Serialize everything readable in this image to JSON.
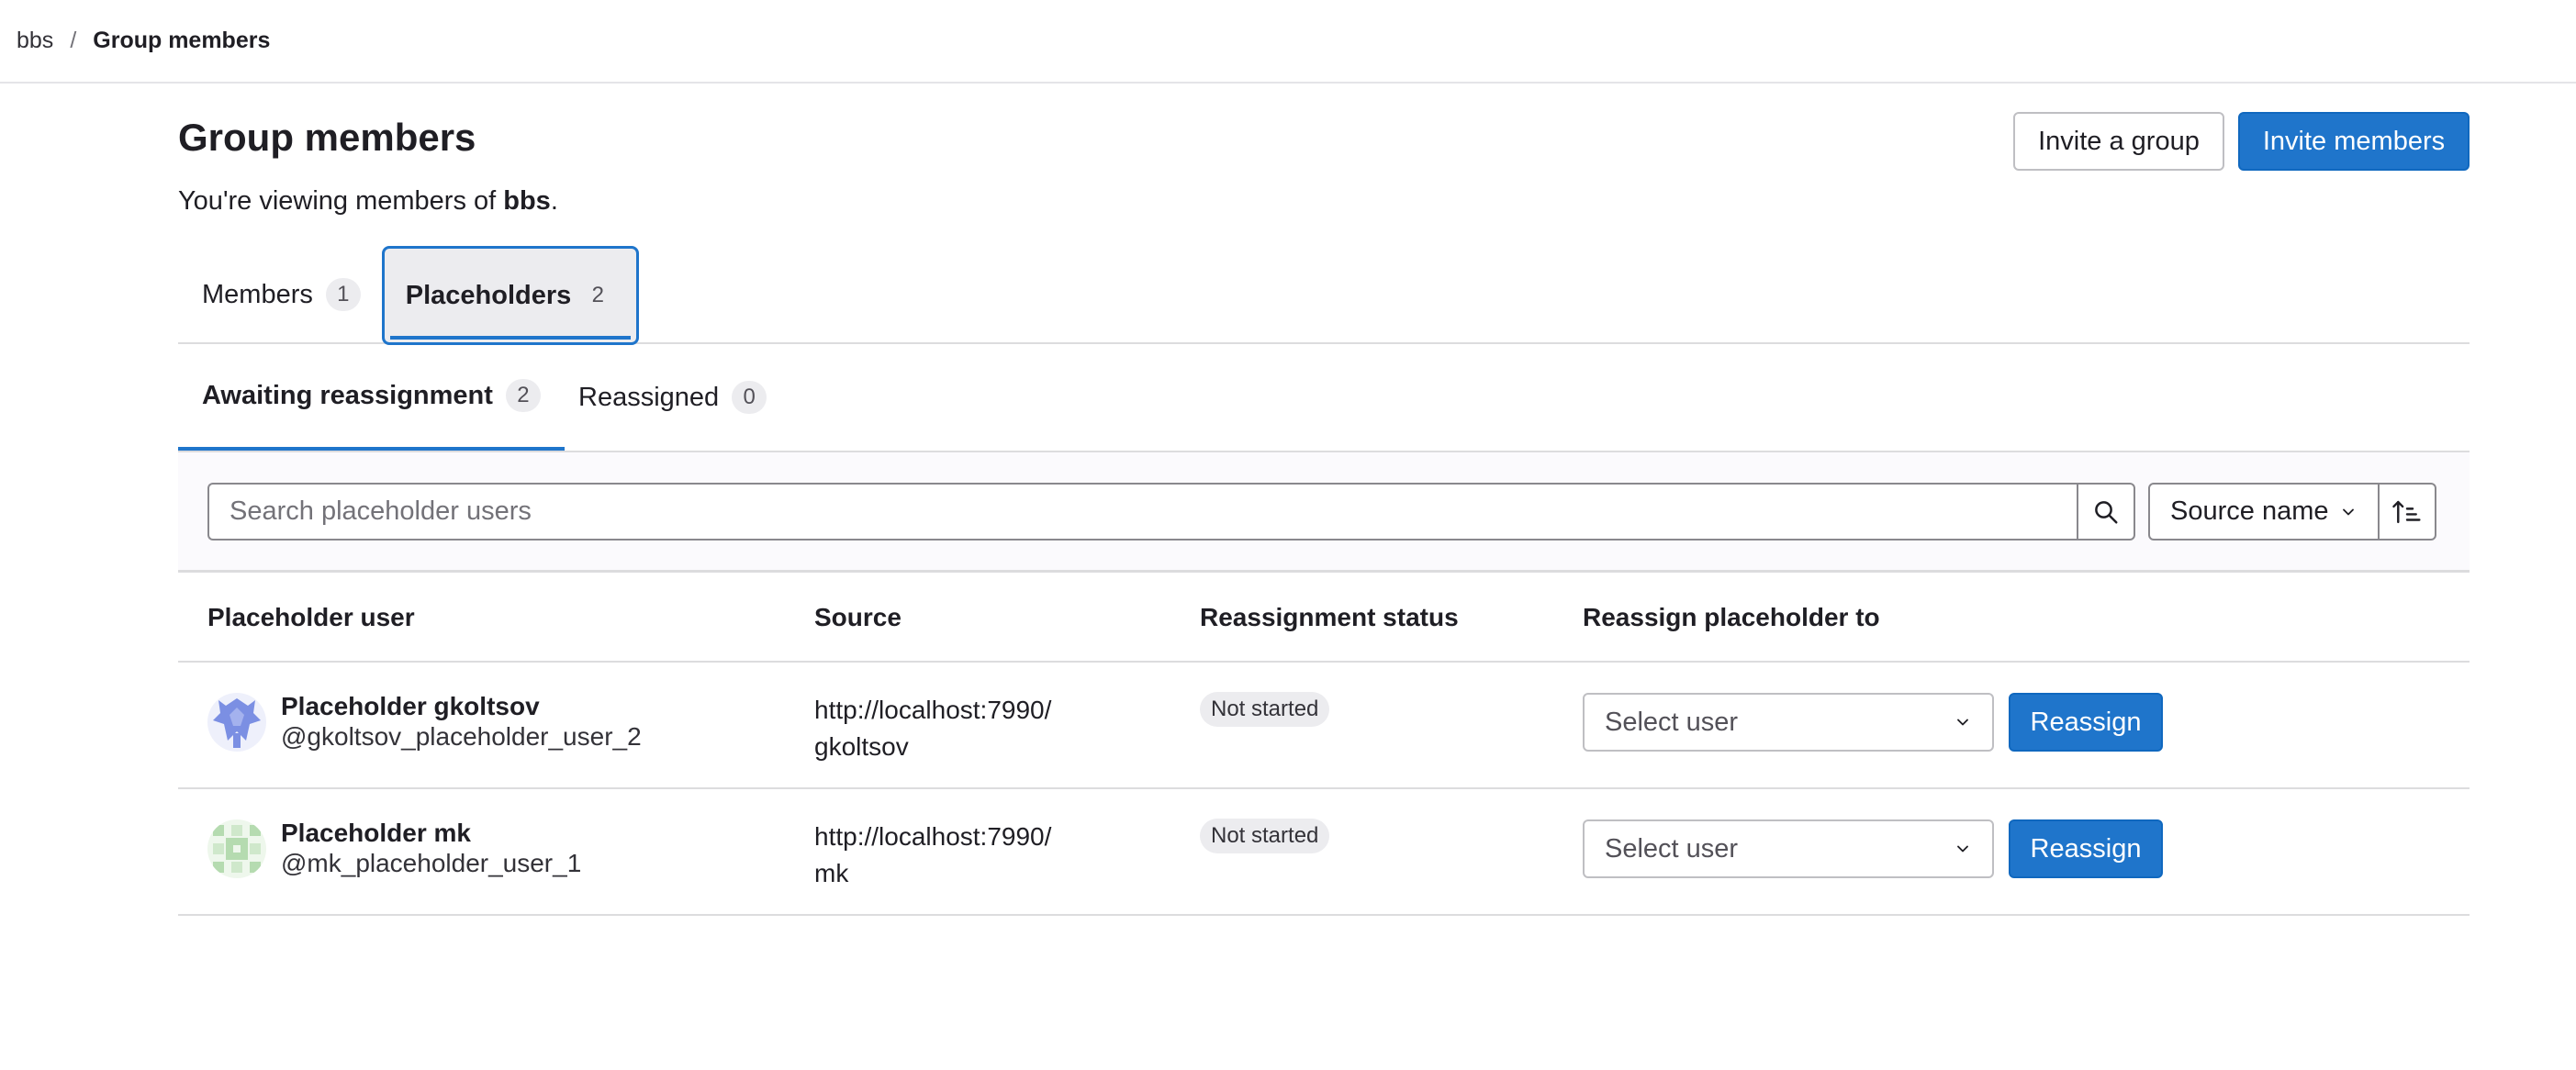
{
  "breadcrumb": {
    "items": [
      "bbs",
      "Group members"
    ],
    "separator": "/"
  },
  "header": {
    "title": "Group members",
    "description_prefix": "You're viewing members of ",
    "description_group": "bbs",
    "description_suffix": ".",
    "invite_group_label": "Invite a group",
    "invite_members_label": "Invite members"
  },
  "tabs": [
    {
      "label": "Members",
      "count": "1",
      "active": false
    },
    {
      "label": "Placeholders",
      "count": "2",
      "active": true
    }
  ],
  "subtabs": [
    {
      "label": "Awaiting reassignment",
      "count": "2",
      "active": true
    },
    {
      "label": "Reassigned",
      "count": "0",
      "active": false
    }
  ],
  "filter": {
    "search_placeholder": "Search placeholder users",
    "search_value": "",
    "sort_by": "Source name",
    "search_icon": "search-icon",
    "sort_direction_icon": "sort-ascending-icon"
  },
  "table": {
    "columns": [
      "Placeholder user",
      "Source",
      "Reassignment status",
      "Reassign placeholder to"
    ],
    "rows": [
      {
        "name": "Placeholder gkoltsov",
        "username": "@gkoltsov_placeholder_user_2",
        "source_line1": "http://localhost:7990/",
        "source_line2": "gkoltsov",
        "status": "Not started",
        "select_placeholder": "Select user",
        "action_label": "Reassign",
        "avatar_color": "#7b8fe3"
      },
      {
        "name": "Placeholder mk",
        "username": "@mk_placeholder_user_1",
        "source_line1": "http://localhost:7990/",
        "source_line2": "mk",
        "status": "Not started",
        "select_placeholder": "Select user",
        "action_label": "Reassign",
        "avatar_color": "#b5dbb0"
      }
    ]
  },
  "colors": {
    "primary": "#1f75cb",
    "text": "#1f1e24",
    "border": "#dcdcde",
    "badge_bg": "#ececef"
  }
}
